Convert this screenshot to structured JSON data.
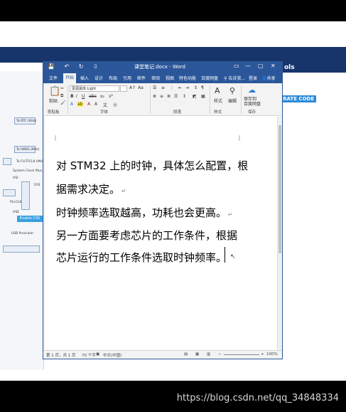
{
  "watermark": "https://blog.csdn.net/qq_34848334",
  "website": {
    "nav_tools": "ols",
    "brand_badge": "GENERATE CODE",
    "clock_labels": [
      "To RTC (KHz)",
      "To IWDG (KHz)",
      "To FLITFCLK (MHz)",
      "System Clock Mux",
      "HSI",
      "SYS",
      "PLLCLK",
      "HSE",
      "Enable CSS",
      "USB Prescaler"
    ]
  },
  "word": {
    "title": "课堂笔记.docx - Word",
    "qat": {
      "save": "💾",
      "undo": "↶",
      "redo": "↻",
      "customize": "⇩"
    },
    "window_controls": [
      "▭",
      "—",
      "▢",
      "✕"
    ],
    "tabs": [
      "文件",
      "开始",
      "插入",
      "设计",
      "布局",
      "引用",
      "邮件",
      "审阅",
      "视图",
      "特色功能",
      "百度网盘"
    ],
    "active_tab": "开始",
    "tell_me": "告诉我...",
    "signin": "登录",
    "share": "共享",
    "ribbon": {
      "paste": "粘贴",
      "font_name": "思源黑体 Light",
      "font_size": "",
      "bold": "B",
      "italic": "I",
      "underline": "U",
      "strike": "abc",
      "sub": "x₂",
      "sup": "x²",
      "styles": "样式",
      "edit": "编辑",
      "save_to": "保存到",
      "baidu": "百度网盘",
      "groups": {
        "clipboard": "剪贴板",
        "font": "字体",
        "paragraph": "段落",
        "styles": "样式",
        "save": "保存"
      }
    },
    "document": {
      "lines": [
        "对 STM32 上的时钟，具体怎么配置，根",
        "据需求决定。",
        "时钟频率选取越高，功耗也会更高。",
        "另一方面要考虑芯片的工作条件，根据",
        "芯片运行的工作条件选取时钟频率。"
      ],
      "para_mark": "↵"
    },
    "status": {
      "page": "第 1 页，共 1 页",
      "words": "70 个字",
      "lang": "中文(中国)",
      "zoom": "100%"
    }
  }
}
